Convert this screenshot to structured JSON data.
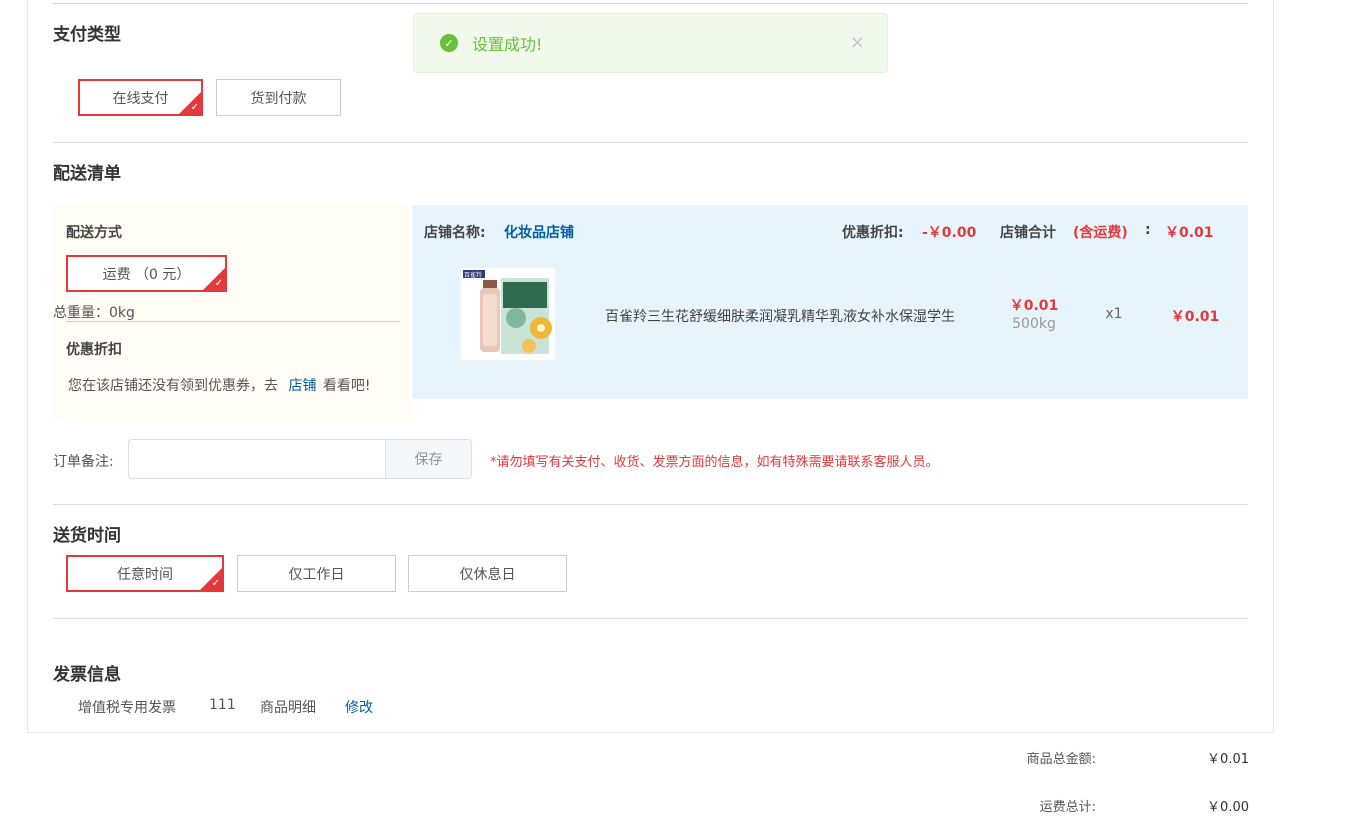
{
  "toast": {
    "message": "设置成功!",
    "close": "×",
    "ok": "✓"
  },
  "payment": {
    "title": "支付类型",
    "options": [
      "在线支付",
      "货到付款"
    ],
    "selected": 0
  },
  "shipping_list": {
    "title": "配送清单",
    "method_label": "配送方式",
    "method_option": "运费 （0 元）",
    "weight_label": "总重量：0kg",
    "discount_label": "优惠折扣",
    "coupon_prefix": "您在该店铺还没有领到优惠券，去",
    "coupon_link": "店铺",
    "coupon_suffix": "看看吧!"
  },
  "shop": {
    "name_label": "店铺名称:",
    "name": "化妆品店铺",
    "discount_label": "优惠折扣:",
    "discount_value": "-￥0.00",
    "total_label": "店铺合计",
    "total_note": "(含运费)",
    "colon": ":",
    "total_value": "￥0.01"
  },
  "product": {
    "name": "百雀羚三生花舒缓细肤柔润凝乳精华乳液女补水保湿学生",
    "price": "￥0.01",
    "weight": "500kg",
    "qty": "x1",
    "subtotal": "￥0.01",
    "brand_text": "百雀羚"
  },
  "order_note": {
    "label": "订单备注:",
    "value": "",
    "save": "保存",
    "hint": "*请勿填写有关支付、收货、发票方面的信息，如有特殊需要请联系客服人员。"
  },
  "delivery_time": {
    "title": "送货时间",
    "options": [
      "任意时间",
      "仅工作日",
      "仅休息日"
    ],
    "selected": 0
  },
  "invoice": {
    "title": "发票信息",
    "type": "增值税专用发票",
    "code": "111",
    "content": "商品明细",
    "edit": "修改"
  },
  "summary": {
    "goods_total_label": "商品总金额:",
    "goods_total_value": "￥0.01",
    "freight_label": "运费总计:",
    "freight_value": "￥0.00"
  },
  "colors": {
    "accent": "#e4393c",
    "link": "#005ea7",
    "success": "#67c23a"
  },
  "icons": {
    "toast": "check-circle-icon",
    "close": "close-icon",
    "tick": "check-corner-icon"
  }
}
